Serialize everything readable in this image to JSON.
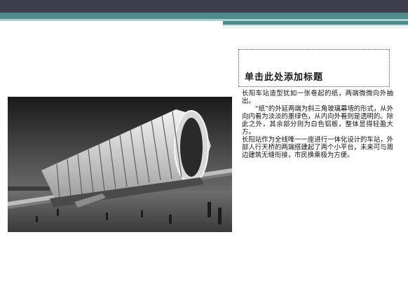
{
  "slide": {
    "title": "单击此处添加标题",
    "paragraphs": [
      "长阳车站造型犹如一张卷起的纸，两端微微向外抽出。",
      "“纸”的外延两端为斜三角玻璃幕墙的形式，从外向内看为淡淡的墨绿色，从内向外看则是透明的。除此之外，其余部分则为白色铝板，整体显得轻盈大方。",
      "长阳站作为全线唯一一座进行一体化设计的车站，外部人行天桥的两端搭建起了两个小平台，未来可与周边建筑无缝衔接，市民换乘极为方便。"
    ]
  },
  "photo": {
    "subject": "station-rendering"
  },
  "colors": {
    "top_bar": "#3e3e4c",
    "accent_teal": "#4e8a8c",
    "accent_light": "#a9cfd0"
  }
}
